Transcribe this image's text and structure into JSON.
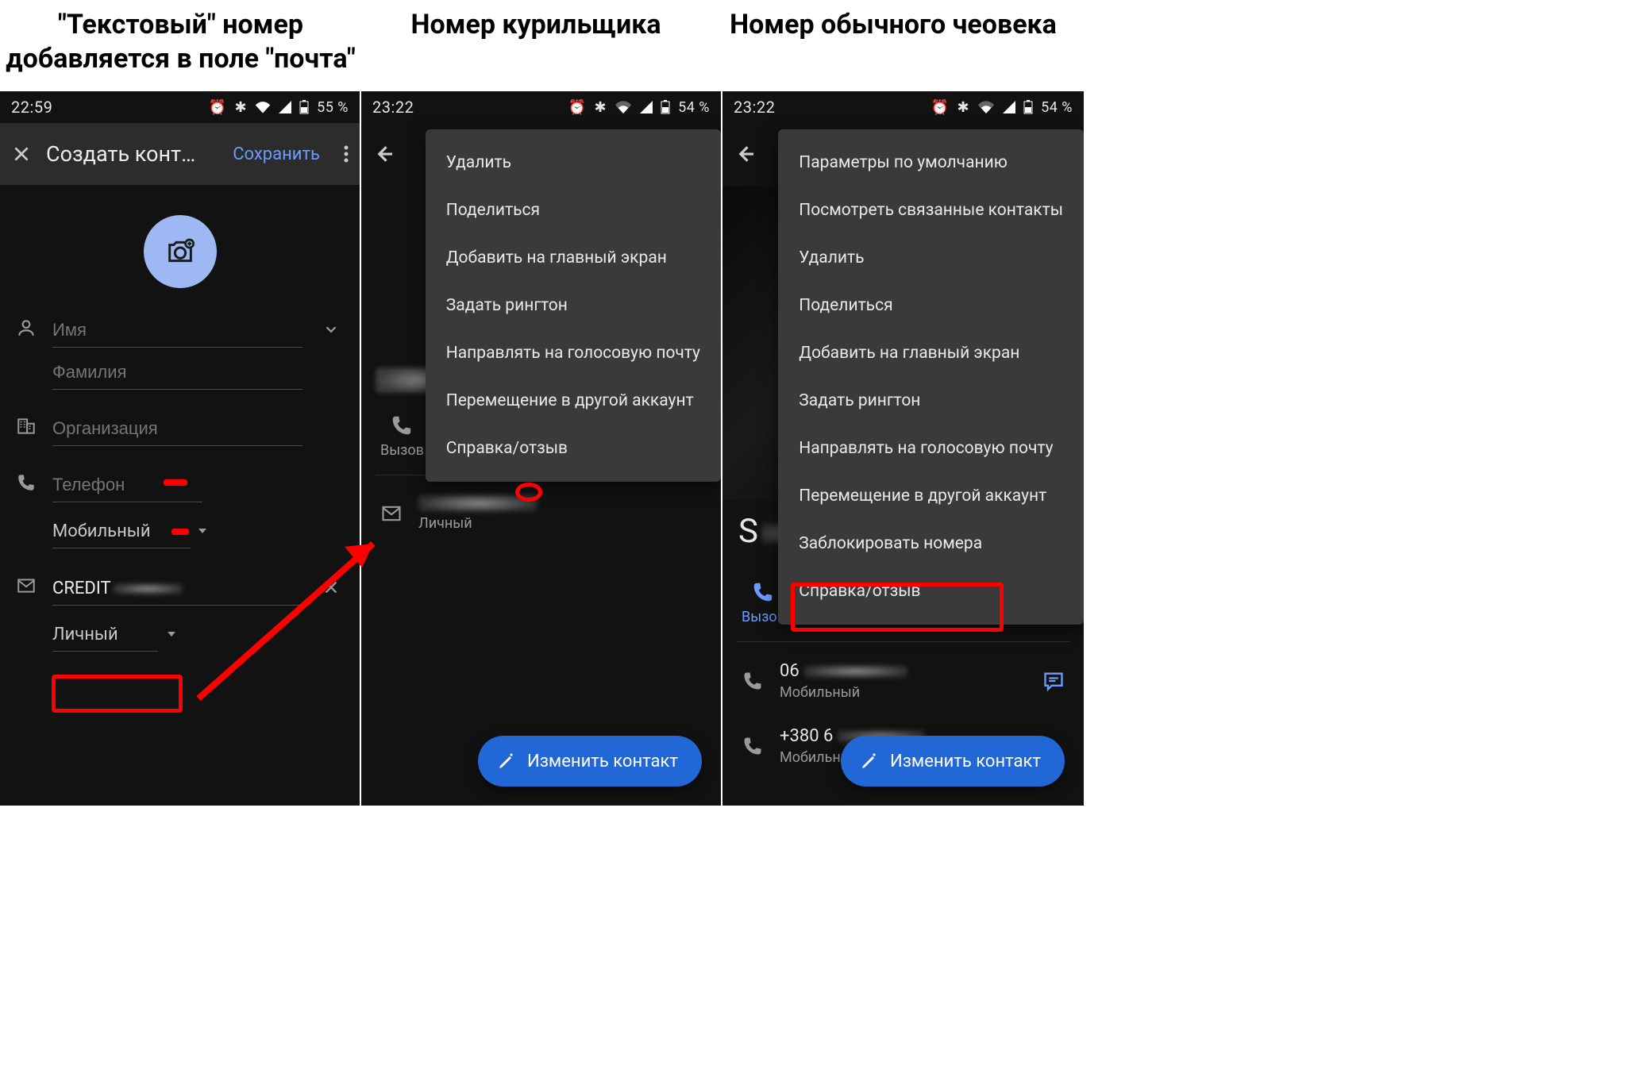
{
  "captions": {
    "c1_l1": "\"Текстовый\" номер",
    "c1_l2": "добавляется в поле \"почта\"",
    "c2": "Номер курильщика",
    "c3": "Номер обычного чеовека"
  },
  "status": {
    "time1": "22:59",
    "time2": "23:22",
    "time3": "23:22",
    "battery1": "55 %",
    "battery2": "54 %",
    "battery3": "54 %"
  },
  "phone1": {
    "title": "Создать конт…",
    "save": "Сохранить",
    "fields": {
      "name": "Имя",
      "surname": "Фамилия",
      "org": "Организация",
      "phone": "Телефон",
      "mobile_type": "Мобильный",
      "email_value": "CREDIT",
      "email_type": "Личный"
    }
  },
  "phone2": {
    "menu": [
      "Удалить",
      "Поделиться",
      "Добавить на главный экран",
      "Задать рингтон",
      "Направлять на голосовую почту",
      "Перемещение в другой аккаунт",
      "Справка/отзыв"
    ],
    "call_label": "Вызов",
    "email_type": "Личный",
    "fab": "Изменить контакт"
  },
  "phone3": {
    "menu": [
      "Параметры по умолчанию",
      "Посмотреть связанные контакты",
      "Удалить",
      "Поделиться",
      "Добавить на главный экран",
      "Задать рингтон",
      "Направлять на голосовую почту",
      "Перемещение в другой аккаунт",
      "Заблокировать номера",
      "Справка/отзыв"
    ],
    "name_initial": "S",
    "call_label": "Вызов",
    "num1_prefix": "06",
    "num1_type": "Мобильный",
    "num2_prefix": "+380 6",
    "num2_type": "Мобильный",
    "fab": "Изменить контакт"
  }
}
